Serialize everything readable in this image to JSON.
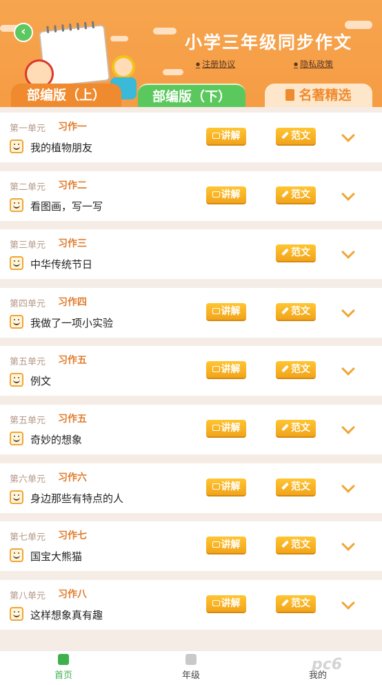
{
  "header": {
    "title": "小学三年级同步作文",
    "links": [
      "注册协议",
      "隐私政策"
    ]
  },
  "tabs": [
    "部编版（上）",
    "部编版（下）",
    "名著精选"
  ],
  "buttons": {
    "lecture": "讲解",
    "essay": "范文"
  },
  "items": [
    {
      "unit": "第一单元",
      "exercise": "习作一",
      "topic": "我的植物朋友",
      "has_lecture": true
    },
    {
      "unit": "第二单元",
      "exercise": "习作二",
      "topic": "看图画，写一写",
      "has_lecture": true
    },
    {
      "unit": "第三单元",
      "exercise": "习作三",
      "topic": "中华传统节日",
      "has_lecture": false
    },
    {
      "unit": "第四单元",
      "exercise": "习作四",
      "topic": "我做了一项小实验",
      "has_lecture": true
    },
    {
      "unit": "第五单元",
      "exercise": "习作五",
      "topic": "例文",
      "has_lecture": true
    },
    {
      "unit": "第五单元",
      "exercise": "习作五",
      "topic": "奇妙的想象",
      "has_lecture": true
    },
    {
      "unit": "第六单元",
      "exercise": "习作六",
      "topic": "身边那些有特点的人",
      "has_lecture": true
    },
    {
      "unit": "第七单元",
      "exercise": "习作七",
      "topic": "国宝大熊猫",
      "has_lecture": true
    },
    {
      "unit": "第八单元",
      "exercise": "习作八",
      "topic": "这样想象真有趣",
      "has_lecture": true
    }
  ],
  "nav": [
    "首页",
    "年级",
    "我的"
  ],
  "watermark": "pc6"
}
